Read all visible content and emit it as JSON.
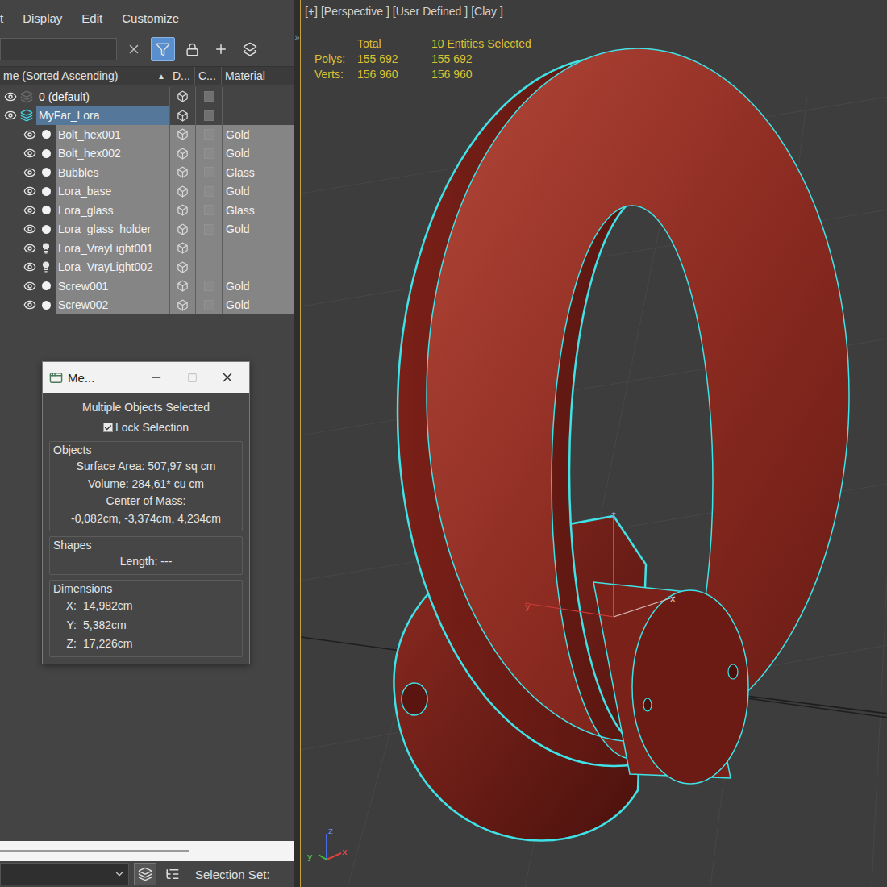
{
  "menu": [
    {
      "label": "t"
    },
    {
      "label": "Display"
    },
    {
      "label": "Edit"
    },
    {
      "label": "Customize"
    }
  ],
  "toolbar": {
    "search": "",
    "filter_on": true,
    "overflow": "»"
  },
  "columns": [
    {
      "label": "me (Sorted Ascending)",
      "sort": "▲"
    },
    {
      "label": "D..."
    },
    {
      "label": "C..."
    },
    {
      "label": "Material"
    }
  ],
  "rows": [
    {
      "name": "0 (default)",
      "kind": "layer",
      "selected": false,
      "current": false,
      "material": ""
    },
    {
      "name": "MyFar_Lora",
      "kind": "layer",
      "selected": true,
      "current": true,
      "material": ""
    },
    {
      "name": "Bolt_hex001",
      "kind": "object",
      "selected": true,
      "current": false,
      "material": "Gold"
    },
    {
      "name": "Bolt_hex002",
      "kind": "object",
      "selected": true,
      "current": false,
      "material": "Gold"
    },
    {
      "name": "Bubbles",
      "kind": "object",
      "selected": true,
      "current": false,
      "material": "Glass"
    },
    {
      "name": "Lora_base",
      "kind": "object",
      "selected": true,
      "current": false,
      "material": "Gold"
    },
    {
      "name": "Lora_glass",
      "kind": "object",
      "selected": true,
      "current": false,
      "material": "Glass"
    },
    {
      "name": "Lora_glass_holder",
      "kind": "object",
      "selected": true,
      "current": false,
      "material": "Gold"
    },
    {
      "name": "Lora_VrayLight001",
      "kind": "light",
      "selected": true,
      "current": false,
      "material": ""
    },
    {
      "name": "Lora_VrayLight002",
      "kind": "light",
      "selected": true,
      "current": false,
      "material": ""
    },
    {
      "name": "Screw001",
      "kind": "object",
      "selected": true,
      "current": false,
      "material": "Gold"
    },
    {
      "name": "Screw002",
      "kind": "object",
      "selected": true,
      "current": false,
      "material": "Gold"
    }
  ],
  "dialog": {
    "title": "Me...",
    "maximize_enabled": false,
    "heading": "Multiple Objects Selected",
    "lock": {
      "label": "Lock Selection",
      "checked": true
    },
    "groups": [
      {
        "title": "Objects",
        "lines": [
          {
            "kind": "center",
            "text": "Surface Area: 507,97 sq cm"
          },
          {
            "kind": "center",
            "text": "Volume: 284,61* cu cm"
          },
          {
            "kind": "center",
            "text": "Center of Mass:"
          },
          {
            "kind": "center",
            "text": "-0,082cm, -3,374cm, 4,234cm"
          }
        ]
      },
      {
        "title": "Shapes",
        "lines": [
          {
            "kind": "center",
            "text": "Length: ---"
          }
        ]
      },
      {
        "title": "Dimensions",
        "lines": [
          {
            "kind": "pair",
            "label": "X:",
            "value": "14,982cm"
          },
          {
            "kind": "pair",
            "label": "Y:",
            "value": "5,382cm"
          },
          {
            "kind": "pair",
            "label": "Z:",
            "value": "17,226cm"
          }
        ]
      }
    ]
  },
  "bottom_bar": {
    "selection_set": "Selection Set:"
  },
  "viewport": {
    "labels": [
      "[+]",
      "[Perspective ]",
      "[User Defined ]",
      "[Clay ]"
    ],
    "stats": {
      "columns": [
        "Total",
        "10 Entities Selected"
      ],
      "rows": [
        {
          "label": "Polys:",
          "total": "155 692",
          "selected": "155 692"
        },
        {
          "label": "Verts:",
          "total": "156 960",
          "selected": "156 960"
        }
      ]
    },
    "axes": {
      "x": "x",
      "y": "y",
      "z": "z"
    }
  }
}
